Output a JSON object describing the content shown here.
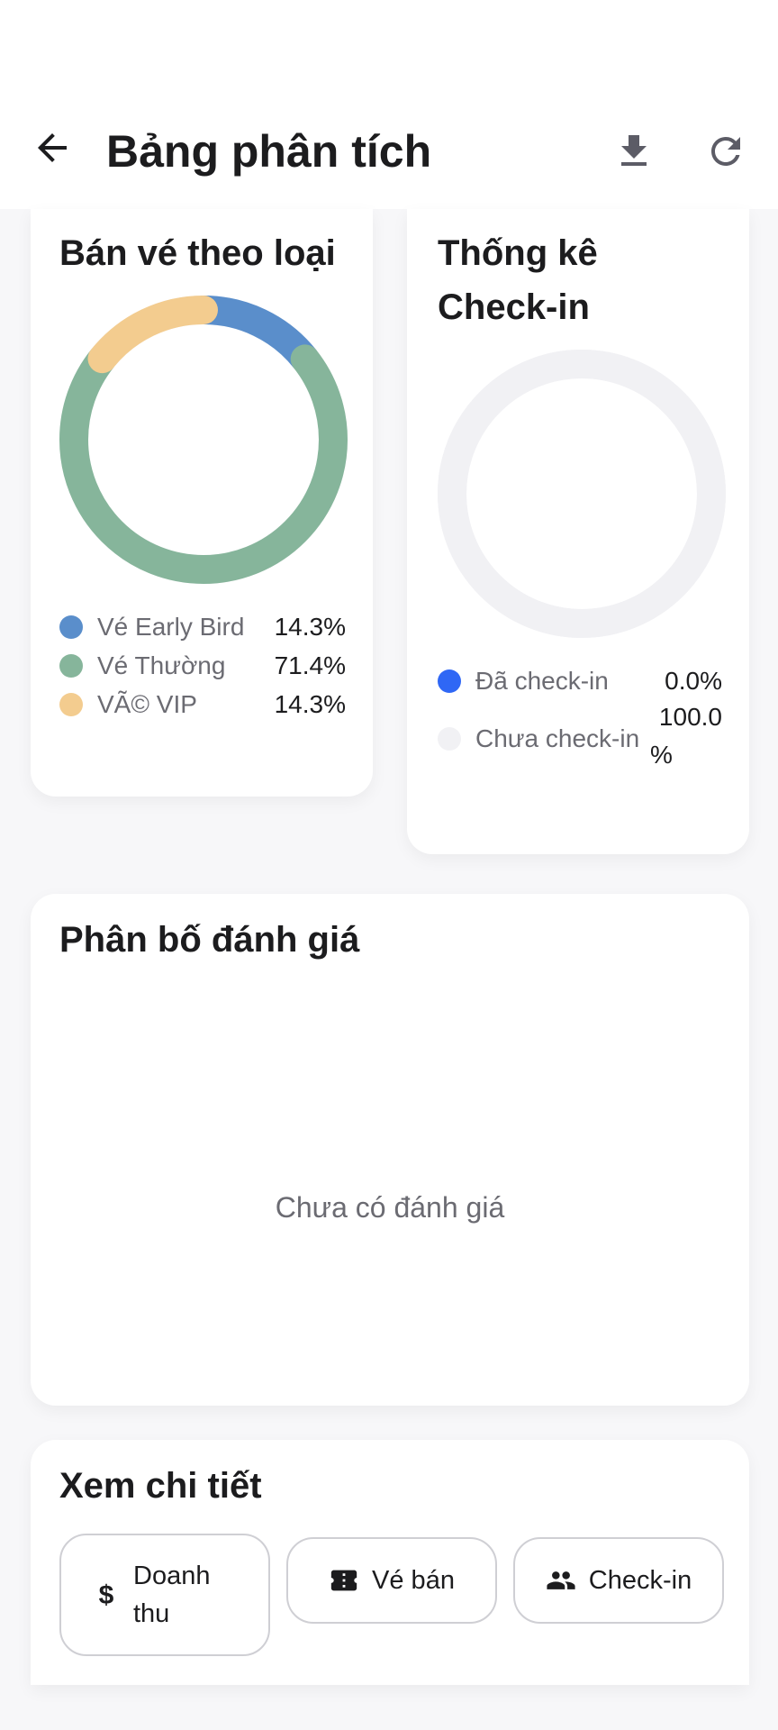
{
  "header": {
    "title": "Bảng phân tích",
    "back_icon": "arrow-left-icon",
    "download_icon": "download-icon",
    "refresh_icon": "refresh-icon"
  },
  "ticket_sales_card": {
    "title": "Bán vé theo loại",
    "legend": [
      {
        "label": "Vé Early Bird",
        "value": "14.3%",
        "color": "#5a8ecb"
      },
      {
        "label": "Vé Thường",
        "value": "71.4%",
        "color": "#86b59b"
      },
      {
        "label": "VÃ© VIP",
        "value": "14.3%",
        "color": "#f3cc8f"
      }
    ]
  },
  "checkin_card": {
    "title_line1": "Thống kê",
    "title_line2": "Check-in",
    "legend": [
      {
        "label": "Đã check-in",
        "value": "0.0%",
        "color": "#2f67f5"
      },
      {
        "label": "Chưa check-in",
        "value_line1": "100.0",
        "value_line2": "%",
        "color": "#f1f1f4"
      }
    ]
  },
  "rating_card": {
    "title": "Phân bố đánh giá",
    "empty_text": "Chưa có đánh giá"
  },
  "details_card": {
    "title": "Xem chi tiết",
    "buttons": [
      {
        "label_line1": "Doanh",
        "label_line2": "thu",
        "icon": "dollar-icon"
      },
      {
        "label": "Vé bán",
        "icon": "ticket-icon"
      },
      {
        "label": "Check-in",
        "icon": "people-icon"
      }
    ]
  },
  "chart_data": [
    {
      "type": "pie",
      "title": "Bán vé theo loại",
      "categories": [
        "Vé Early Bird",
        "Vé Thường",
        "VÃ© VIP"
      ],
      "values": [
        14.3,
        71.4,
        14.3
      ]
    },
    {
      "type": "pie",
      "title": "Thống kê Check-in",
      "categories": [
        "Đã check-in",
        "Chưa check-in"
      ],
      "values": [
        0.0,
        100.0
      ]
    }
  ]
}
